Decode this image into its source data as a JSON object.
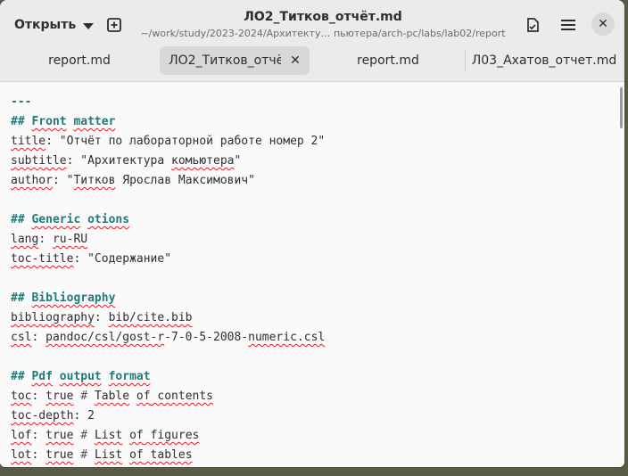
{
  "header": {
    "open_label": "Открыть",
    "title": "ЛО2_Титков_отчёт.md",
    "subtitle": "~/work/study/2023-2024/Архитекту… пьютера/arch-pc/labs/lab02/report"
  },
  "tabs": [
    {
      "label": "report.md"
    },
    {
      "label": "ЛО2_Титков_отчёт",
      "close": "✕"
    },
    {
      "label": "report.md"
    },
    {
      "label": "Л03_Ахатов_отчет.md"
    }
  ],
  "icons": {
    "new_document": "new-document-icon",
    "save": "save-icon",
    "menu": "hamburger-menu-icon",
    "close_window": "close-icon",
    "close_glyph": "✕"
  },
  "editor": {
    "lines": [
      {
        "t1": "---",
        "t2": "",
        "t3": "",
        "t4": "",
        "t5": "",
        "t6": "",
        "t7": "",
        "t8": ""
      },
      {
        "t1": "## ",
        "t2": "Front",
        "t3": " ",
        "t4": "matter",
        "t5": "",
        "t6": "",
        "t7": "",
        "t8": ""
      },
      {
        "t1": "title",
        "t2": ": \"Отчёт по лабораторной работе номер 2\"",
        "t3": "",
        "t4": "",
        "t5": "",
        "t6": "",
        "t7": "",
        "t8": ""
      },
      {
        "t1": "subtitle",
        "t2": ": \"Архитектура ",
        "t3": "комьютера",
        "t4": "\"",
        "t5": "",
        "t6": "",
        "t7": "",
        "t8": ""
      },
      {
        "t1": "author",
        "t2": ": \"",
        "t3": "Титков",
        "t4": " Ярослав Максимович\"",
        "t5": "",
        "t6": "",
        "t7": "",
        "t8": ""
      },
      {
        "t1": "",
        "t2": "",
        "t3": "",
        "t4": "",
        "t5": "",
        "t6": "",
        "t7": "",
        "t8": ""
      },
      {
        "t1": "## ",
        "t2": "Generic",
        "t3": " ",
        "t4": "otions",
        "t5": "",
        "t6": "",
        "t7": "",
        "t8": ""
      },
      {
        "t1": "lang",
        "t2": ": ",
        "t3": "ru-RU",
        "t4": "",
        "t5": "",
        "t6": "",
        "t7": "",
        "t8": ""
      },
      {
        "t1": "toc-title",
        "t2": ": \"Содержание\"",
        "t3": "",
        "t4": "",
        "t5": "",
        "t6": "",
        "t7": "",
        "t8": ""
      },
      {
        "t1": "",
        "t2": "",
        "t3": "",
        "t4": "",
        "t5": "",
        "t6": "",
        "t7": "",
        "t8": ""
      },
      {
        "t1": "## ",
        "t2": "Bibliography",
        "t3": "",
        "t4": "",
        "t5": "",
        "t6": "",
        "t7": "",
        "t8": ""
      },
      {
        "t1": "bibliography",
        "t2": ": ",
        "t3": "bib/cite.bib",
        "t4": "",
        "t5": "",
        "t6": "",
        "t7": "",
        "t8": ""
      },
      {
        "t1": "csl",
        "t2": ": ",
        "t3": "pandoc/csl/gost-r",
        "t4": "-7-0-5-2008-",
        "t5": "numeric.csl",
        "t6": "",
        "t7": "",
        "t8": ""
      },
      {
        "t1": "",
        "t2": "",
        "t3": "",
        "t4": "",
        "t5": "",
        "t6": "",
        "t7": "",
        "t8": ""
      },
      {
        "t1": "## ",
        "t2": "Pdf",
        "t3": " ",
        "t4": "output",
        "t5": " ",
        "t6": "format",
        "t7": "",
        "t8": ""
      },
      {
        "t1": "toc",
        "t2": ": ",
        "t3": "true",
        "t4": " # ",
        "t5": "Table",
        "t6": " ",
        "t7": "of",
        "t8": " contents"
      },
      {
        "t1": "toc-depth",
        "t2": ": 2",
        "t3": "",
        "t4": "",
        "t5": "",
        "t6": "",
        "t7": "",
        "t8": ""
      },
      {
        "t1": "lof",
        "t2": ": ",
        "t3": "true",
        "t4": " # ",
        "t5": "List",
        "t6": " ",
        "t7": "of",
        "t8": " figures"
      },
      {
        "t1": "lot",
        "t2": ": ",
        "t3": "true",
        "t4": " # ",
        "t5": "List",
        "t6": " ",
        "t7": "of",
        "t8": " tables"
      }
    ]
  },
  "colors": {
    "heading": "#1f7a7a",
    "spellcheck": "#e01b24",
    "headerbar": "#ebebeb",
    "editor_bg": "#fafafa"
  }
}
